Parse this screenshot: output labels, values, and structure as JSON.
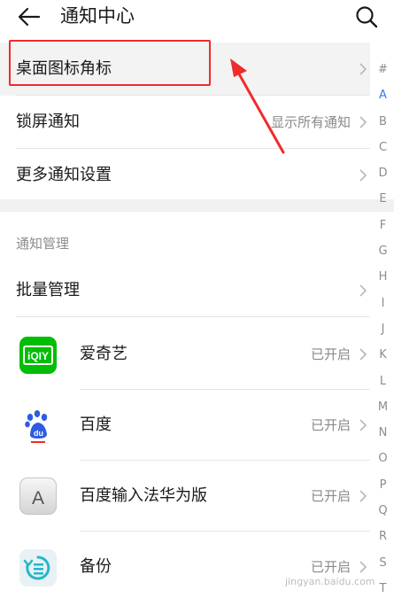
{
  "header": {
    "title": "通知中心"
  },
  "top_items": [
    {
      "label": "桌面图标角标",
      "value": ""
    },
    {
      "label": "锁屏通知",
      "value": "显示所有通知"
    },
    {
      "label": "更多通知设置",
      "value": ""
    }
  ],
  "section": {
    "title": "通知管理",
    "batch_label": "批量管理"
  },
  "apps": [
    {
      "name": "爱奇艺",
      "status": "已开启",
      "icon": "iqiyi-icon",
      "icon_text": "iQIY"
    },
    {
      "name": "百度",
      "status": "已开启",
      "icon": "baidu-icon",
      "icon_text": "du"
    },
    {
      "name": "百度输入法华为版",
      "status": "已开启",
      "icon": "baidu-input-icon",
      "icon_text": "A"
    },
    {
      "name": "备份",
      "status": "已开启",
      "icon": "backup-icon",
      "icon_text": ""
    }
  ],
  "alpha_index": [
    "#",
    "A",
    "B",
    "C",
    "D",
    "E",
    "F",
    "G",
    "H",
    "I",
    "J",
    "K",
    "L",
    "M",
    "N",
    "O",
    "P",
    "Q",
    "R",
    "S",
    "T"
  ],
  "alpha_active": "A",
  "colors": {
    "accent": "#2f7bf6",
    "annotation": "#ef2b2b",
    "iqiyi_green": "#00be06",
    "baidu_blue": "#2d5be3"
  },
  "watermark": "jingyan.baidu.com"
}
